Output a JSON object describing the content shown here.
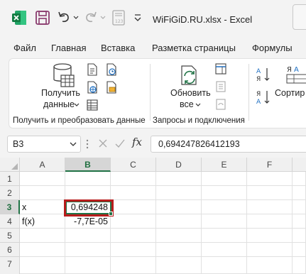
{
  "titlebar": {
    "doc_title": "WiFiGiD.RU.xlsx  -  Excel"
  },
  "tabs": [
    "Файл",
    "Главная",
    "Вставка",
    "Разметка страницы",
    "Формулы"
  ],
  "ribbon": {
    "get_data_line1": "Получить",
    "get_data_line2": "данные",
    "group1_label": "Получить и преобразовать данные",
    "refresh_line1": "Обновить",
    "refresh_line2": "все",
    "group2_label": "Запросы и подключения",
    "sort_label": "Сортир"
  },
  "formula_bar": {
    "name_box": "B3",
    "fx": "fx",
    "formula": "0,694247826412193"
  },
  "grid": {
    "columns": [
      "A",
      "B",
      "C",
      "D",
      "E",
      "F"
    ],
    "rows": [
      "1",
      "2",
      "3",
      "4",
      "5",
      "6",
      "7"
    ],
    "active_cell": "B3",
    "cells": {
      "a3": "x",
      "b3": "0,694248",
      "a4": "f(x)",
      "b4": "-7,7E-05"
    }
  },
  "colors": {
    "excel_green": "#217346",
    "highlight_red": "#b71c1c"
  }
}
